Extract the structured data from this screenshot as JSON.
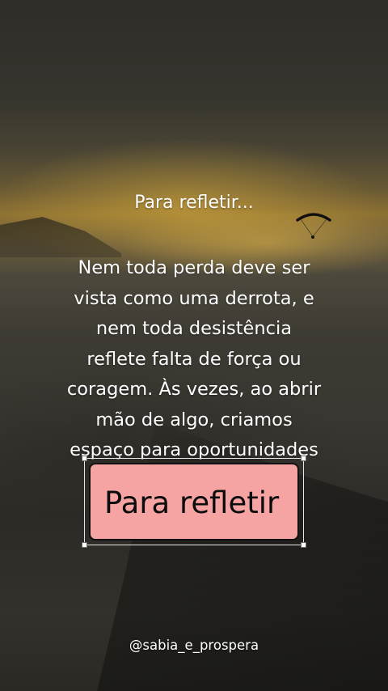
{
  "post": {
    "heading": "Para refletir...",
    "quote_lines": [
      "Nem toda perda deve ser",
      "vista como uma derrota, e",
      "nem toda desistência",
      "reflete falta de força ou",
      "coragem. Às vezes, ao abrir",
      "mão de algo, criamos",
      "espaço para oportunidades"
    ]
  },
  "title_box": {
    "label": "Para refletir",
    "background": "#f6a3a3",
    "border_color": "#111111"
  },
  "footer": {
    "handle": "@sabia_e_prospera"
  },
  "icons": {
    "paraglider": "paraglider-icon"
  }
}
